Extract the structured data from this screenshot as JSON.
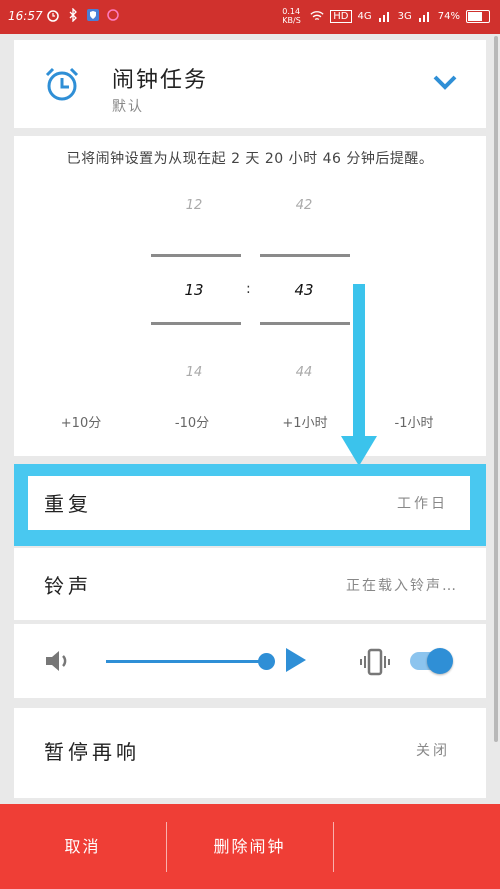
{
  "status_bar": {
    "time": "16:57",
    "net_speed": "0.14 KB/S",
    "hd": "HD",
    "sig1": "4G",
    "sig2": "3G",
    "battery": "74%"
  },
  "header": {
    "title": "闹钟任务",
    "subtitle": "默认"
  },
  "picker": {
    "notice": "已将闹钟设置为从现在起 2 天 20 小时 46 分钟后提醒。",
    "hour_prev": "12",
    "hour_current": "13",
    "hour_next": "14",
    "separator": ":",
    "minute_prev": "42",
    "minute_current": "43",
    "minute_next": "44",
    "adjust_buttons": [
      "+10分",
      "-10分",
      "+1小时",
      "-1小时"
    ]
  },
  "repeat": {
    "label": "重复",
    "value": "工作日"
  },
  "ringtone": {
    "label": "铃声",
    "value": "正在载入铃声…"
  },
  "volume": {
    "level": 0.95,
    "vibrate_on": true
  },
  "snooze": {
    "label": "暂停再响",
    "value": "关闭"
  },
  "bottom_bar": {
    "cancel": "取消",
    "delete": "删除闹钟"
  },
  "colors": {
    "accent": "#2f8fd6",
    "highlight": "#49c8f0",
    "bar": "#ef3e36",
    "status": "#d0312d"
  }
}
